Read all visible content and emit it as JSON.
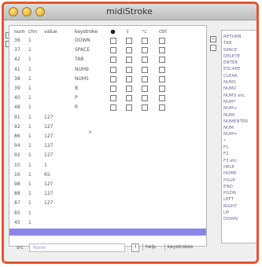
{
  "window": {
    "title": "midiStroke"
  },
  "table": {
    "headers": {
      "num": "num",
      "chn": "chn",
      "value": "value",
      "keystroke": "keystroke"
    },
    "modifier_icons": [
      "command-icon",
      "shift-icon",
      "option-icon"
    ],
    "ctrl_label": "ctrl",
    "rows": [
      {
        "num": "36",
        "chn": "1",
        "value": "",
        "key": "DOWN"
      },
      {
        "num": "37",
        "chn": "1",
        "value": "",
        "key": "SPACE"
      },
      {
        "num": "42",
        "chn": "1",
        "value": "",
        "key": "TAB"
      },
      {
        "num": "41",
        "chn": "1",
        "value": "",
        "key": "NUM9"
      },
      {
        "num": "38",
        "chn": "1",
        "value": "",
        "key": "NUM5"
      },
      {
        "num": "39",
        "chn": "1",
        "value": "",
        "key": "B"
      },
      {
        "num": "40",
        "chn": "1",
        "value": "",
        "key": "P"
      },
      {
        "num": "48",
        "chn": "1",
        "value": "",
        "key": "R"
      },
      {
        "num": "91",
        "chn": "1",
        "value": "127",
        "key": ""
      },
      {
        "num": "92",
        "chn": "1",
        "value": "127",
        "key": ""
      },
      {
        "num": "86",
        "chn": "1",
        "value": "127",
        "key": ""
      },
      {
        "num": "94",
        "chn": "1",
        "value": "127",
        "key": ""
      },
      {
        "num": "92",
        "chn": "1",
        "value": "127",
        "key": ""
      },
      {
        "num": "10",
        "chn": "1",
        "value": "1",
        "key": ""
      },
      {
        "num": "16",
        "chn": "1",
        "value": "65",
        "key": ""
      },
      {
        "num": "98",
        "chn": "1",
        "value": "127",
        "key": ""
      },
      {
        "num": "88",
        "chn": "1",
        "value": "127",
        "key": ""
      },
      {
        "num": "87",
        "chn": "1",
        "value": "127",
        "key": ""
      },
      {
        "num": "85",
        "chn": "1",
        "value": "",
        "key": ""
      },
      {
        "num": "45",
        "chn": "1",
        "value": "",
        "key": ""
      },
      {
        "num": "",
        "chn": "",
        "value": "",
        "key": ""
      }
    ],
    "arrow": ">"
  },
  "keystroke_list": [
    "RETURN",
    "TAB",
    "SPACE",
    "DELETE",
    "ENTER",
    "ESCAPE",
    "CLEAR",
    "NUM1",
    "NUM2",
    "NUM3 etc.",
    "NUM*",
    "NUM+",
    "NUM/",
    "NUMENTER",
    "NUM.",
    "NUM=",
    "*",
    "F1",
    "F2",
    "F3 etc.",
    "HELP",
    "HOME",
    "PGUP",
    "END",
    "PGDN",
    "LEFT",
    "RIGHT",
    "UP",
    "DOWN"
  ],
  "footer": {
    "src_label": "src",
    "src_value": "None",
    "stepper": "↕",
    "help_label": "help",
    "keystrokes_label": "keystrokes"
  },
  "colors": {
    "frame": "#e4562e",
    "selection": "#8a86e6"
  }
}
